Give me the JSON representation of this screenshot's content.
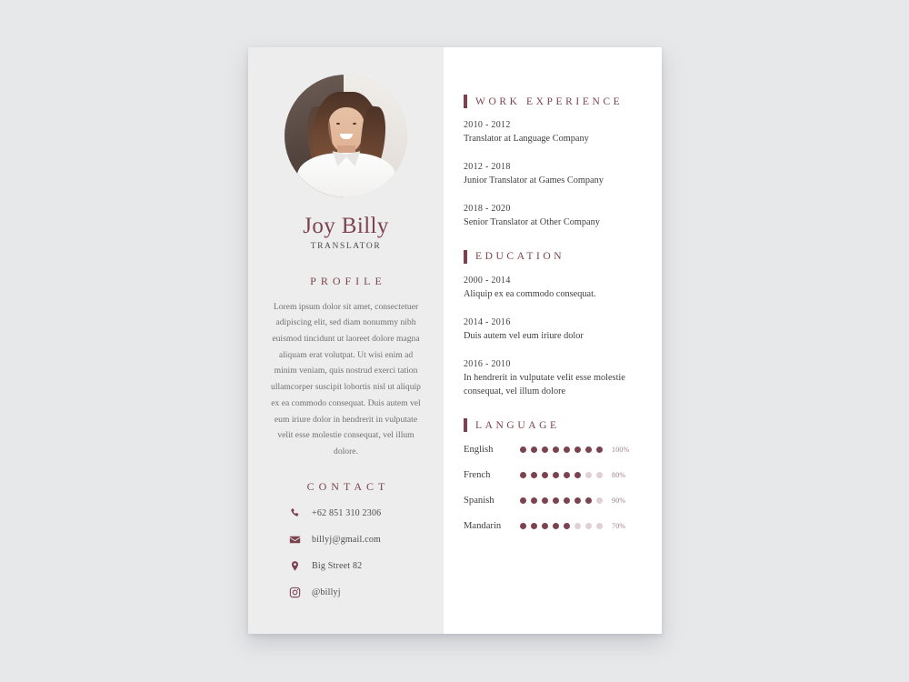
{
  "card": {
    "accent_color": "#7b4350",
    "left_panel_bg": "#eeedee",
    "right_panel_bg": "#ffffff",
    "page_bg": "#e7e8ea"
  },
  "profile": {
    "name": "Joy Billy",
    "job_title": "TRANSLATOR",
    "photo_alt": "portrait-photo",
    "profile_heading": "PROFILE",
    "profile_text": "Lorem ipsum dolor sit amet, consectetuer adipiscing elit, sed diam nonummy nibh euismod tincidunt ut laoreet dolore magna aliquam erat volutpat. Ut wisi enim ad minim veniam, quis nostrud exerci tation ullamcorper suscipit lobortis nisl ut aliquip ex ea commodo consequat. Duis autem vel eum iriure dolor in hendrerit in vulputate velit esse molestie consequat, vel illum dolore."
  },
  "contact": {
    "heading": "CONTACT",
    "items": [
      {
        "icon": "phone-icon",
        "value": "+62 851 310 2306"
      },
      {
        "icon": "envelope-icon",
        "value": "billyj@gmail.com"
      },
      {
        "icon": "map-pin-icon",
        "value": "Big Street 82"
      },
      {
        "icon": "instagram-icon",
        "value": "@billyj"
      }
    ]
  },
  "work_experience": {
    "heading": "WORK EXPERIENCE",
    "entries": [
      {
        "date": "2010 - 2012",
        "desc": "Translator at Language Company"
      },
      {
        "date": "2012 - 2018",
        "desc": "Junior Translator at Games Company"
      },
      {
        "date": "2018 - 2020",
        "desc": "Senior Translator at Other Company"
      }
    ]
  },
  "education": {
    "heading": "EDUCATION",
    "entries": [
      {
        "date": "2000 - 2014",
        "desc": "Aliquip ex ea commodo consequat."
      },
      {
        "date": "2014 - 2016",
        "desc": "Duis autem vel eum iriure dolor"
      },
      {
        "date": "2016 - 2010",
        "desc": "In hendrerit in vulputate velit esse molestie consequat, vel illum dolore"
      }
    ]
  },
  "language": {
    "heading": "LANGUAGE",
    "total_dots": 8,
    "items": [
      {
        "name": "English",
        "filled": 8,
        "percent": "100%"
      },
      {
        "name": "French",
        "filled": 6,
        "percent": "80%"
      },
      {
        "name": "Spanish",
        "filled": 7,
        "percent": "90%"
      },
      {
        "name": "Mandarin",
        "filled": 5,
        "percent": "70%"
      }
    ]
  }
}
